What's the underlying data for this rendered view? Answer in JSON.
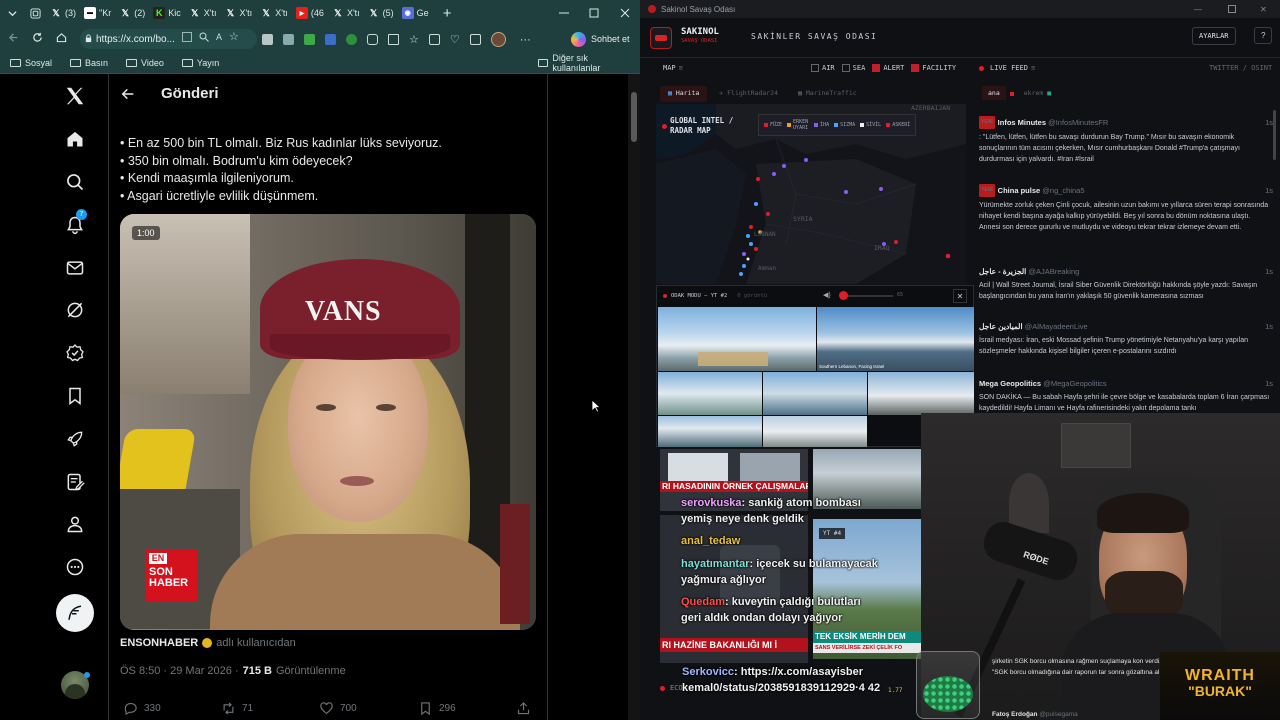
{
  "browser": {
    "tabs": [
      {
        "label": "(3)",
        "type": "x"
      },
      {
        "label": "\"Kr",
        "type": "news"
      },
      {
        "label": "(2)",
        "type": "x"
      },
      {
        "label": "Kic",
        "type": "kick"
      },
      {
        "label": "(46",
        "type": "yt"
      },
      {
        "label": "X'tı",
        "type": "x"
      },
      {
        "label": "X'tı",
        "type": "x"
      },
      {
        "label": "X'tı",
        "type": "x"
      },
      {
        "label": "(46",
        "type": "yt"
      },
      {
        "label": "X'tı",
        "type": "x"
      },
      {
        "label": "(5)",
        "type": "x"
      },
      {
        "label": "Ge",
        "type": "gemini"
      }
    ],
    "url": "https://x.com/bo...",
    "copilot_label": "Sohbet et",
    "bookmarks": [
      "Sosyal",
      "Basın",
      "Video",
      "Yayın"
    ],
    "other_bookmarks": "Diğer sık kullanılanlar"
  },
  "twitter": {
    "header_title": "Gönderi",
    "notification_count": "7",
    "tweet_lines": [
      "• En az 500 bin TL olmalı. Biz Rus kadınlar lüks seviyoruz.",
      "• 350 bin olmalı. Bodrum'u kim ödeyecek?",
      "• Kendi maaşımla ilgileniyorum.",
      "• Asgari ücretliyle evlilik düşünmem."
    ],
    "video_time": "1:00",
    "cap_text": "VANS",
    "logo_line1": "EN",
    "logo_line2": "SON",
    "logo_line3": "HABER",
    "source_name": "ENSONHABER",
    "source_suffix": "adlı kullanıcıdan",
    "timestamp": "ÖS 8:50 · 29 Mar 2026 ·",
    "views": "715 B",
    "views_label": "Görüntülenme",
    "replies": "330",
    "reposts": "71",
    "likes": "700",
    "bookmarks": "296"
  },
  "app": {
    "window_title": "Sakinol Savaş Odası",
    "brand": "SAKINOL",
    "brand_sub": "SAVAŞ ODASI",
    "room_title": "SAKİNLER SAVAŞ ODASI",
    "settings": "AYARLAR",
    "map_label": "MAP",
    "filters": [
      {
        "label": "AIR",
        "on": false
      },
      {
        "label": "SEA",
        "on": false
      },
      {
        "label": "ALERT",
        "on": true
      },
      {
        "label": "FACILITY",
        "on": true
      }
    ],
    "live_feed": "LIVE FEED",
    "feed_source": "TWITTER / OSINT",
    "map_tabs": [
      "Harita",
      "FlightRadar24",
      "MarineTraffic"
    ],
    "feed_tabs": [
      "ana",
      "ekrem"
    ],
    "map_title": "GLOBAL INTEL / RADAR MAP",
    "legend": [
      "FÜZE",
      "ERKEN UYARI",
      "İHA",
      "SIZMA",
      "SİVİL",
      "ASKERİ"
    ],
    "map_places": [
      "AZERBAIJAN",
      "SYRIA",
      "IRAQ",
      "LÜBNAN",
      "Amman"
    ],
    "focus_mode": "ODAK MODU — YT #2",
    "focus_sub": "0 görüntü",
    "volume_value": "65",
    "cam_captions": [
      "Southern Lebanon, Facing Israel"
    ],
    "yt4_label": "YT #4",
    "ticker_red1": "RI HASADININ ÖRNEK ÇALIŞMALAR",
    "ticker_teal1": "TEK EKSİK MERİH DEM",
    "ticker_red2": "RI HAZİNE BAKANLIĞI MI İ",
    "ticker_white2": "SANS VERİLİRSE ZEKİ ÇELİK FO",
    "feed": [
      {
        "new": true,
        "name": "Infos Minutes",
        "handle": "@InfosMinutesFR",
        "time": "1s",
        "text": ": \"Lütfen, lütfen, lütfen bu savaşı durdurun Bay Trump.\" Mısır bu savaşın ekonomik sonuçlarının tüm acısını çekerken, Mısır cumhurbaşkanı Donald #Trump'a çatışmayı durdurması için yalvardı. #Iran #İsrail"
      },
      {
        "new": true,
        "name": "China pulse",
        "handle": "@ng_china5",
        "time": "1s",
        "text": "Yürümekte zorluk çeken Çinli çocuk, ailesinin uzun bakımı ve yıllarca süren terapi sonrasında nihayet kendi başına ayağa kalkıp yürüyebildi. Beş yıl sonra bu dönüm noktasına ulaştı. Annesi son derece gururlu ve mutluydu ve videoyu tekrar tekrar izlemeye devam etti."
      },
      {
        "new": false,
        "name": "الجزيرة - عاجل",
        "handle": "@AJABreaking",
        "time": "1s",
        "text": "Acil | Wall Street Journal, İsrail Siber Güvenlik Direktörlüğü hakkında şöyle yazdı: Savaşın başlangıcından bu yana İran'ın yaklaşık 50 güvenlik kamerasına sızması"
      },
      {
        "new": false,
        "name": "الميادين عاجل",
        "handle": "@AlMayadeenLive",
        "time": "1s",
        "text": "İsrail medyası: İran, eski Mossad şefinin Trump yönetimiyle Netanyahu'ya karşı yapılan sözleşmeler hakkında kişisel bilgiler içeren e-postalarını sızdırdı"
      },
      {
        "new": false,
        "name": "Mega Geopolitics",
        "handle": "@MegaGeopolitics",
        "time": "1s",
        "text": "SON DAKİKA — Bu sabah Hayfa şehri ile çevre bölge ve kasabalarda toplam 6 İran çarpması kaydedildi! Hayfa Limanı ve Hayfa rafinerisindeki yakıt depolama tankı"
      }
    ],
    "feed_bottom": {
      "text": "şirketin SGK borcu olmasına rağmen suçlamaya kon verdi. Uzun, \"SGK borcu olmadığına dair raporun tar sonra gözaltına alınıyor.",
      "name": "Fatoş Erdoğan",
      "handle": "@pulsegama"
    },
    "ticker_bottom": "ECO",
    "ticker_num": "1.77"
  },
  "chat": [
    {
      "user": "serovkuska",
      "text": "sankiğ atom bombası yemiş neye denk geldik",
      "color": "#f2a0ff"
    },
    {
      "user": "anal_tedaw",
      "text": "",
      "color": "#e9c23a"
    },
    {
      "user": "hayatımantar",
      "text": "içecek su bulamayacak yağmura ağlıyor",
      "color": "#7ee0d7"
    },
    {
      "user": "Quedam",
      "text": "kuveytin çaldığı bulutları geri aldık ondan dolayı yağıyor",
      "color": "#ff4d4d"
    },
    {
      "user": "Serkovicc",
      "text": "https://x.com/asayisber kemal0/status/2038591839112929·4 42",
      "color": "#9fb6ff"
    }
  ],
  "overlay": {
    "brand_top": "WRAITH",
    "brand_bottom": "\"BURAK\"",
    "mic_brand": "RØDE"
  }
}
